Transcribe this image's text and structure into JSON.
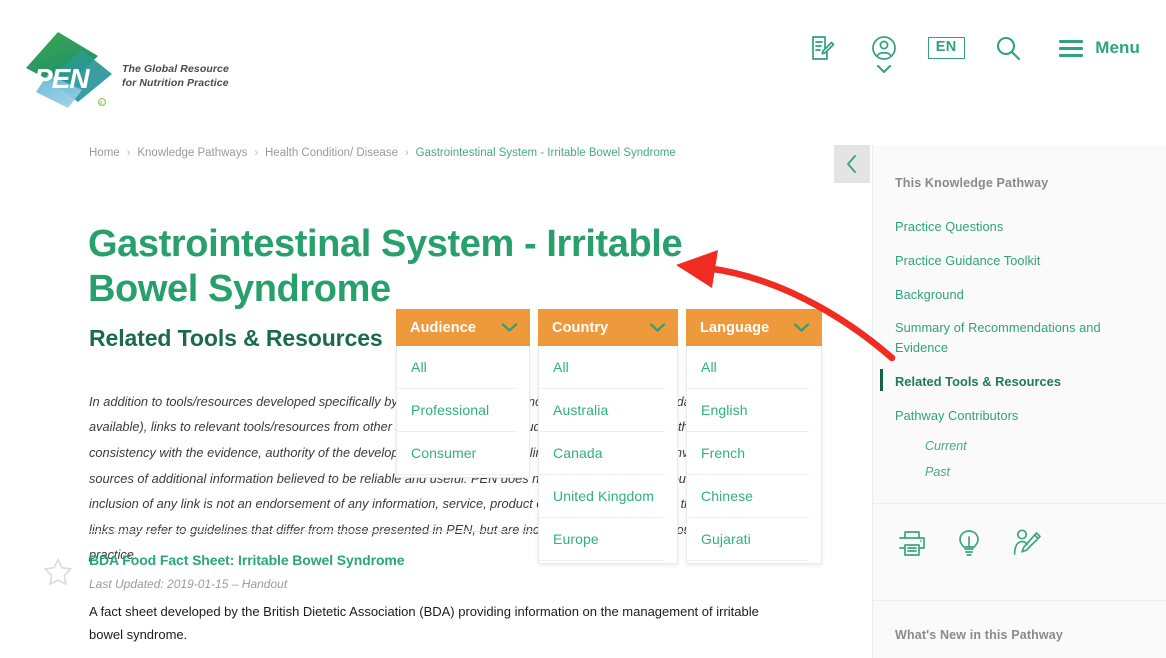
{
  "header": {
    "logo_alt": "PEN",
    "tagline_line1": "The Global Resource",
    "tagline_line2": "for Nutrition Practice",
    "language_code": "EN",
    "menu_label": "Menu",
    "icons": {
      "note": "note-edit-icon",
      "account": "user-account-icon",
      "language": "language-selector",
      "search": "search-icon",
      "menu": "hamburger-menu-icon"
    }
  },
  "breadcrumb": {
    "items": [
      {
        "label": "Home",
        "current": false
      },
      {
        "label": "Knowledge Pathways",
        "current": false
      },
      {
        "label": "Health Condition/ Disease",
        "current": false
      },
      {
        "label": "Gastrointestinal System - Irritable Bowel Syndrome",
        "current": true
      }
    ],
    "separator": "›"
  },
  "main": {
    "page_title": "Gastrointestinal System - Irritable Bowel Syndrome",
    "section_title": "Related Tools & Resources",
    "intro_paragraph": "In addition to tools/resources developed specifically by the PEN team (which includes translations and adaptations where available), links to relevant tools/resources from other sources have been included in this Knowledge Pathway based on their consistency with the evidence, authority of the developer and usability. These links are provided as a convenience and as sources of additional information believed to be reliable and useful. PEN does not control the linked resources and the inclusion of any link is not an endorsement of any information, service, product or company. Please note that some of the links may refer to guidelines that differ from those presented in PEN, but are included to reflect current country guidelines and practice."
  },
  "filters": [
    {
      "name": "Audience",
      "options": [
        "All",
        "Professional",
        "Consumer"
      ]
    },
    {
      "name": "Country",
      "options": [
        "All",
        "Australia",
        "Canada",
        "United Kingdom",
        "Europe"
      ]
    },
    {
      "name": "Language",
      "options": [
        "All",
        "English",
        "French",
        "Chinese",
        "Gujarati"
      ]
    }
  ],
  "results": [
    {
      "title": "BDA Food Fact Sheet: Irritable Bowel Syndrome",
      "meta": "Last Updated: 2019-01-15 – Handout",
      "description": "A fact sheet developed by the British Dietetic Association (BDA) providing information on the management of irritable bowel syndrome."
    }
  ],
  "sidebar": {
    "collapse_icon": "chevron-left-icon",
    "heading": "This Knowledge Pathway",
    "nav": [
      {
        "label": "Practice Questions",
        "active": false,
        "sub": false
      },
      {
        "label": "Practice Guidance Toolkit",
        "active": false,
        "sub": false
      },
      {
        "label": "Background",
        "active": false,
        "sub": false
      },
      {
        "label": "Summary of Recommendations and Evidence",
        "active": false,
        "sub": false
      },
      {
        "label": "Related Tools & Resources",
        "active": true,
        "sub": false
      },
      {
        "label": "Pathway Contributors",
        "active": false,
        "sub": false
      },
      {
        "label": "Current",
        "active": false,
        "sub": true
      },
      {
        "label": "Past",
        "active": false,
        "sub": true
      }
    ],
    "action_icons": [
      {
        "name": "print-icon"
      },
      {
        "name": "lightbulb-idea-icon"
      },
      {
        "name": "contributor-edit-icon"
      }
    ],
    "whats_new_heading": "What's New in this Pathway"
  },
  "colors": {
    "brand_green": "#2fa37a",
    "title_green": "#28a06c",
    "dark_green": "#1a6b4a",
    "filter_orange": "#ee9a3c",
    "annotation_red": "#ef2b22",
    "muted_gray": "#9a9a9a"
  }
}
